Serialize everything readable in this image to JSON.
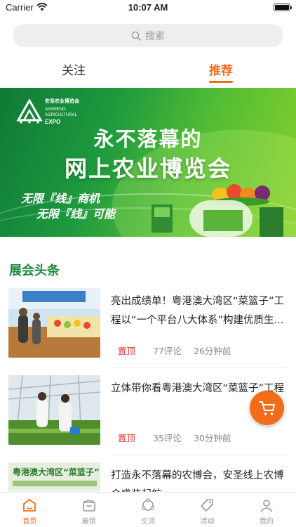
{
  "status_bar": {
    "carrier": "Carrier",
    "time": "10:07 AM"
  },
  "search": {
    "placeholder": "搜索"
  },
  "tabs": [
    {
      "label": "关注",
      "active": false
    },
    {
      "label": "推荐",
      "active": true
    }
  ],
  "banner": {
    "logo_cn": "安圣农业博览会",
    "logo_en1": "ANSHENG",
    "logo_en2": "AGRICULTURAL",
    "logo_en3": "EXPO",
    "headline_1": "永不落幕的",
    "headline_2": "网上农业博览会",
    "slogan_1": "无限『线』商机",
    "slogan_2": "无限『线』可能"
  },
  "section": {
    "title": "展会头条"
  },
  "news": [
    {
      "title": "亮出成绩单！粤港澳大湾区“菜篮子”工程以“一个平台八大体系”构建优质生...",
      "pin": "置顶",
      "comments": "77评论",
      "time": "26分钟前"
    },
    {
      "title": "立体带你看粤港澳大湾区“菜篮子”工程",
      "pin": "置顶",
      "comments": "35评论",
      "time": "30分钟前"
    },
    {
      "title": "打造永不落幕的农博会，安圣线上农博会盛装起航",
      "pin": "",
      "comments": "",
      "time": "",
      "thumb_text": "粤港澳大湾区“菜篮子”"
    }
  ],
  "tabbar": [
    {
      "label": "首页",
      "icon": "home-icon",
      "active": true
    },
    {
      "label": "展馆",
      "icon": "pavilion-icon",
      "active": false
    },
    {
      "label": "交流",
      "icon": "community-icon",
      "active": false
    },
    {
      "label": "活动",
      "icon": "tag-icon",
      "active": false
    },
    {
      "label": "我的",
      "icon": "profile-icon",
      "active": false
    }
  ],
  "colors": {
    "accent": "#f36c1a",
    "brand_green": "#1f8a3c",
    "pin_red": "#e23b3b"
  }
}
